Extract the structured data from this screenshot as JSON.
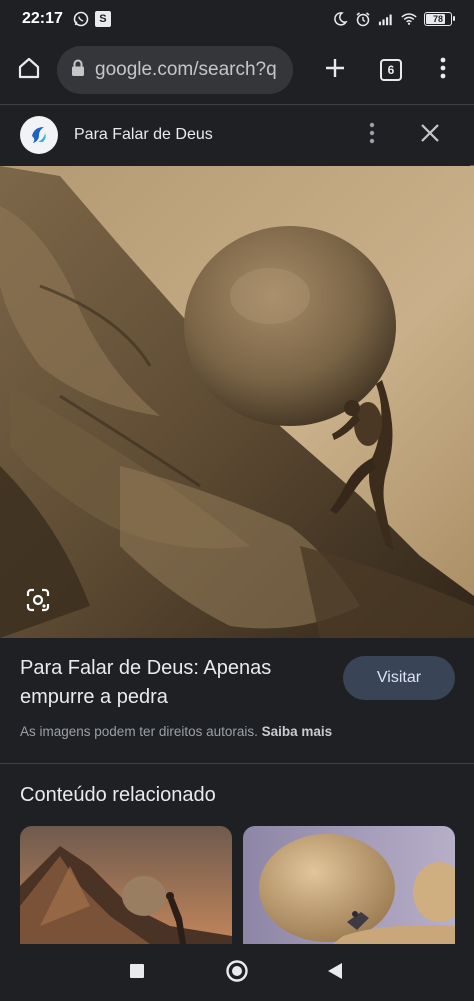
{
  "status_bar": {
    "time": "22:17",
    "left_icons": [
      "whatsapp-icon",
      "s-badge-icon"
    ],
    "s_badge_label": "S",
    "battery_percent": 78,
    "battery_label": "78",
    "right_icons": [
      "moon-icon",
      "alarm-icon",
      "signal-icon",
      "wifi-icon",
      "battery-icon"
    ]
  },
  "browser": {
    "url": "google.com/search?q",
    "tabs_count": "6",
    "icons": [
      "home-icon",
      "lock-icon",
      "plus-icon",
      "tabs-icon",
      "menu-dots-icon"
    ]
  },
  "source": {
    "name": "Para Falar de Deus",
    "icons": [
      "source-logo-icon",
      "more-vert-icon",
      "close-icon"
    ]
  },
  "result": {
    "title": "Para Falar de Deus: Apenas empurre a pedra",
    "visit_label": "Visitar",
    "copyright_text": "As imagens podem ter direitos autorais.",
    "learn_more_label": "Saiba mais",
    "lens_icon": "google-lens-icon"
  },
  "related": {
    "heading": "Conteúdo relacionado"
  },
  "nav": {
    "icons": [
      "recent-apps-icon",
      "home-circle-icon",
      "back-triangle-icon"
    ]
  },
  "colors": {
    "background": "#1f2023",
    "omnibox": "#35363a",
    "visit_button": "#394457",
    "text_primary": "#e8eaed",
    "text_secondary": "#9aa0a6"
  }
}
